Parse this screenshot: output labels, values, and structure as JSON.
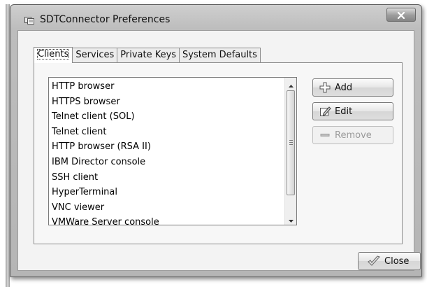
{
  "window": {
    "title": "SDTConnector Preferences"
  },
  "tabs": [
    {
      "label": "Clients",
      "active": true
    },
    {
      "label": "Services",
      "active": false
    },
    {
      "label": "Private Keys",
      "active": false
    },
    {
      "label": "System Defaults",
      "active": false
    }
  ],
  "clients": {
    "items": [
      "HTTP browser",
      "HTTPS browser",
      "Telnet client (SOL)",
      "Telnet client",
      "HTTP browser (RSA II)",
      "IBM Director console",
      "SSH client",
      "HyperTerminal",
      "VNC viewer",
      "VMWare Server console"
    ]
  },
  "buttons": {
    "add": "Add",
    "edit": "Edit",
    "remove": "Remove",
    "close": "Close"
  },
  "icons": {
    "window": "app-window-icon",
    "close": "close-icon",
    "add": "plus-icon",
    "edit": "edit-pencil-icon",
    "remove": "minus-icon",
    "ok": "checkmark-icon"
  }
}
